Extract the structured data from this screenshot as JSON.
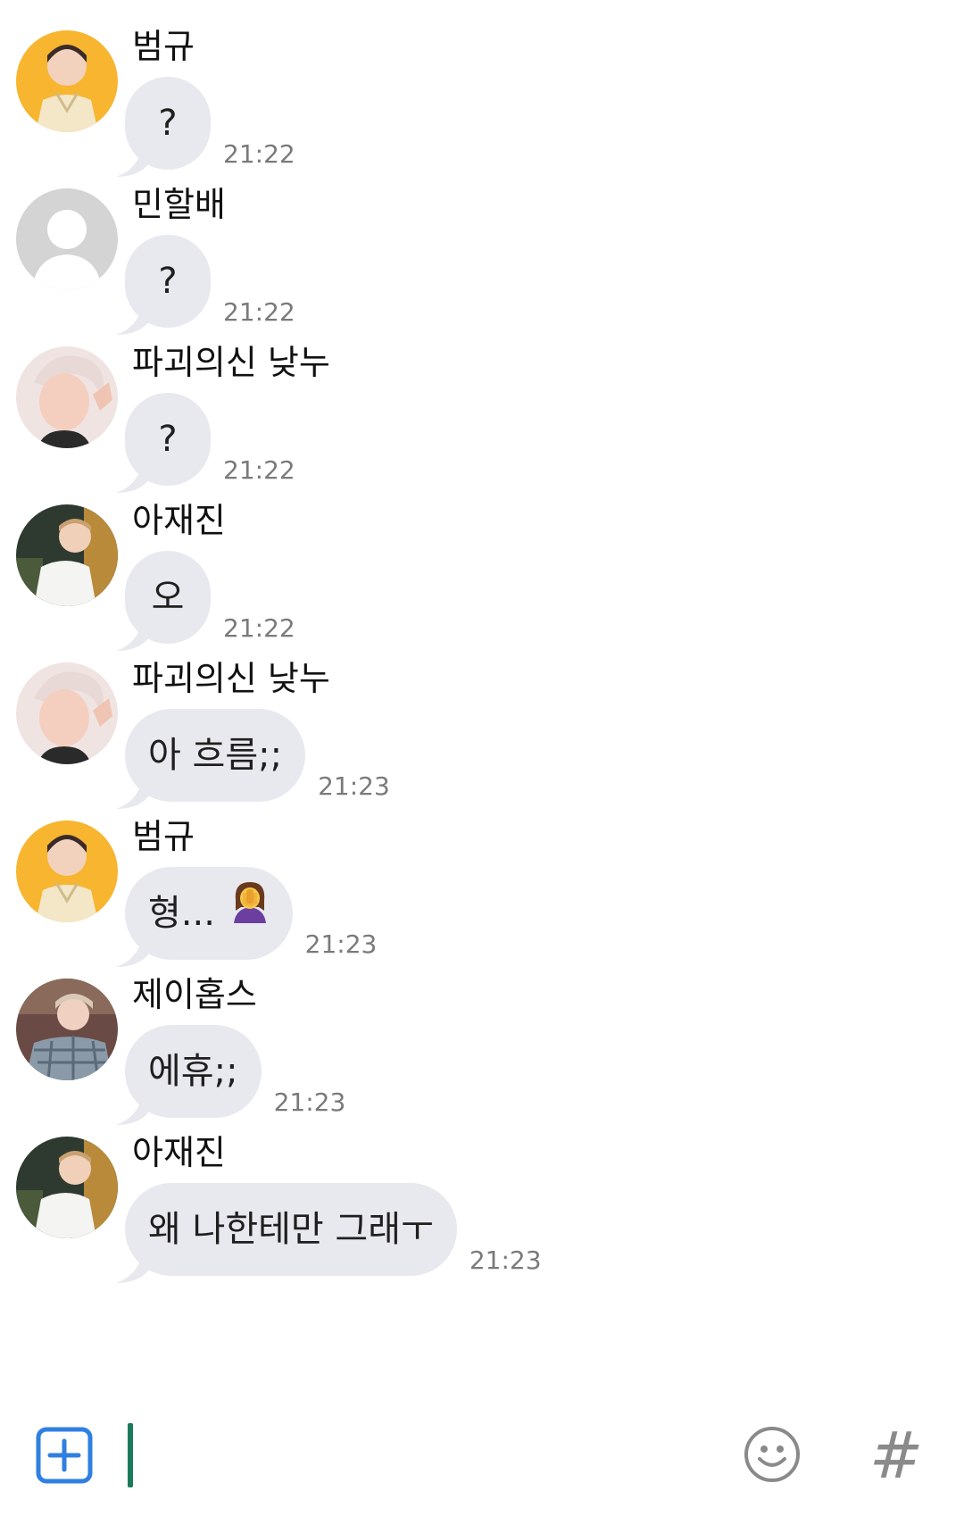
{
  "messages": [
    {
      "sender": "범규",
      "text": "?",
      "time": "21:22",
      "avatar": "avatar-yellow-vest"
    },
    {
      "sender": "민할배",
      "text": "?",
      "time": "21:22",
      "avatar": "avatar-default-person"
    },
    {
      "sender": "파괴의신 낮누",
      "text": "?",
      "time": "21:22",
      "avatar": "avatar-blond-peace"
    },
    {
      "sender": "아재진",
      "text": "오",
      "time": "21:22",
      "avatar": "avatar-white-shirt"
    },
    {
      "sender": "파괴의신 낮누",
      "text": "아 흐름;;",
      "time": "21:23",
      "avatar": "avatar-blond-peace"
    },
    {
      "sender": "범규",
      "text": "형...",
      "emoji": "🤦‍♀️",
      "time": "21:23",
      "avatar": "avatar-yellow-vest"
    },
    {
      "sender": "제이홉스",
      "text": "에휴;;",
      "time": "21:23",
      "avatar": "avatar-plaid-shirt"
    },
    {
      "sender": "아재진",
      "text": "왜 나한테만 그래ㅜ",
      "time": "21:23",
      "avatar": "avatar-white-shirt"
    }
  ],
  "input_bar": {
    "plus_icon": "plus-square-icon",
    "emoji_icon": "smiley-icon",
    "hash_label": "#"
  },
  "colors": {
    "bubble": "#e8e9ee",
    "accent_blue": "#2f7fe0",
    "cursor": "#1b7a5a",
    "time": "#7a7a7a"
  }
}
